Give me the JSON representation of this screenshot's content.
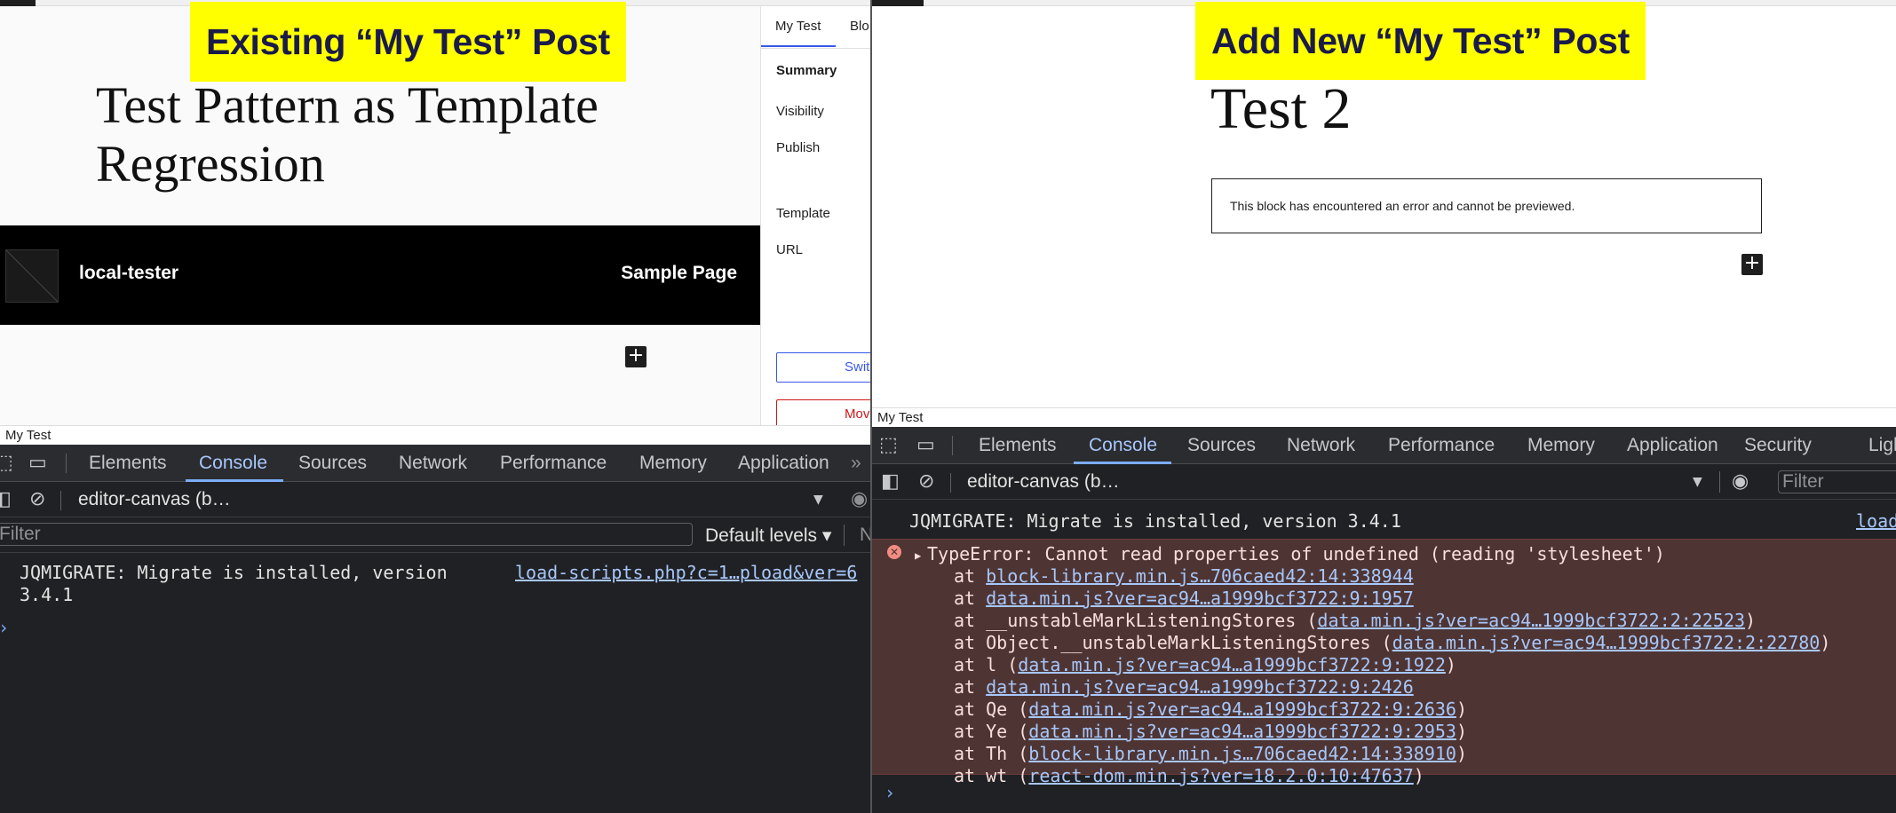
{
  "left": {
    "banner": "Existing “My Test” Post",
    "post_title_line1": "Test Pattern as Template",
    "post_title_line2": "Regression",
    "header": {
      "site_name": "local-tester",
      "nav_link": "Sample Page"
    },
    "inserter": "+",
    "sidebar": {
      "tab_post": "My Test",
      "tab_block": "Blo",
      "summary": "Summary",
      "visibility": "Visibility",
      "publish": "Publish",
      "template": "Template",
      "url": "URL",
      "switch_button": "Switc",
      "move_button": "Mov"
    },
    "status_title": "My Test",
    "devtools": {
      "tabs": [
        "Elements",
        "Console",
        "Sources",
        "Network",
        "Performance",
        "Memory",
        "Application"
      ],
      "more": "»",
      "context": "editor-canvas (b…",
      "filter_placeholder": "Filter",
      "levels": "Default levels ▾",
      "trailing": "N",
      "messages": {
        "jqmigrate_line1": "JQMIGRATE: Migrate is installed, version",
        "jqmigrate_line2": "3.4.1",
        "jqmigrate_source": "load-scripts.php?c=1…pload&ver=6"
      }
    }
  },
  "right": {
    "banner": "Add New “My Test” Post",
    "post_title": "Test 2",
    "block_error": "This block has encountered an error and cannot be previewed.",
    "inserter": "+",
    "status_title": "My Test",
    "devtools": {
      "tabs": [
        "Elements",
        "Console",
        "Sources",
        "Network",
        "Performance",
        "Memory",
        "Application",
        "Security",
        "Ligh"
      ],
      "context": "editor-canvas (b…",
      "filter_placeholder": "Filter",
      "messages": {
        "jqmigrate": "JQMIGRATE: Migrate is installed, version 3.4.1",
        "jqmigrate_source": "load",
        "error_head": "TypeError: Cannot read properties of undefined (reading 'stylesheet')",
        "stack": [
          {
            "prefix": "at ",
            "link": "block-library.min.js…706caed42:14:338944",
            "suffix": ""
          },
          {
            "prefix": "at ",
            "link": "data.min.js?ver=ac94…a1999bcf3722:9:1957",
            "suffix": ""
          },
          {
            "prefix": "at __unstableMarkListeningStores (",
            "link": "data.min.js?ver=ac94…1999bcf3722:2:22523",
            "suffix": ")"
          },
          {
            "prefix": "at Object.__unstableMarkListeningStores (",
            "link": "data.min.js?ver=ac94…1999bcf3722:2:22780",
            "suffix": ")"
          },
          {
            "prefix": "at l (",
            "link": "data.min.js?ver=ac94…a1999bcf3722:9:1922",
            "suffix": ")"
          },
          {
            "prefix": "at ",
            "link": "data.min.js?ver=ac94…a1999bcf3722:9:2426",
            "suffix": ""
          },
          {
            "prefix": "at Qe (",
            "link": "data.min.js?ver=ac94…a1999bcf3722:9:2636",
            "suffix": ")"
          },
          {
            "prefix": "at Ye (",
            "link": "data.min.js?ver=ac94…a1999bcf3722:9:2953",
            "suffix": ")"
          },
          {
            "prefix": "at Th (",
            "link": "block-library.min.js…706caed42:14:338910",
            "suffix": ")"
          },
          {
            "prefix": "at wt (",
            "link": "react-dom.min.js?ver=18.2.0:10:47637",
            "suffix": ")"
          }
        ]
      }
    }
  },
  "colors": {
    "banner_bg": "#ffff00",
    "banner_text": "#1b1b4b",
    "devtools_bg": "#202124",
    "error_bg": "#4e3534",
    "link": "#a8c7fa",
    "accent": "#3858e9"
  }
}
